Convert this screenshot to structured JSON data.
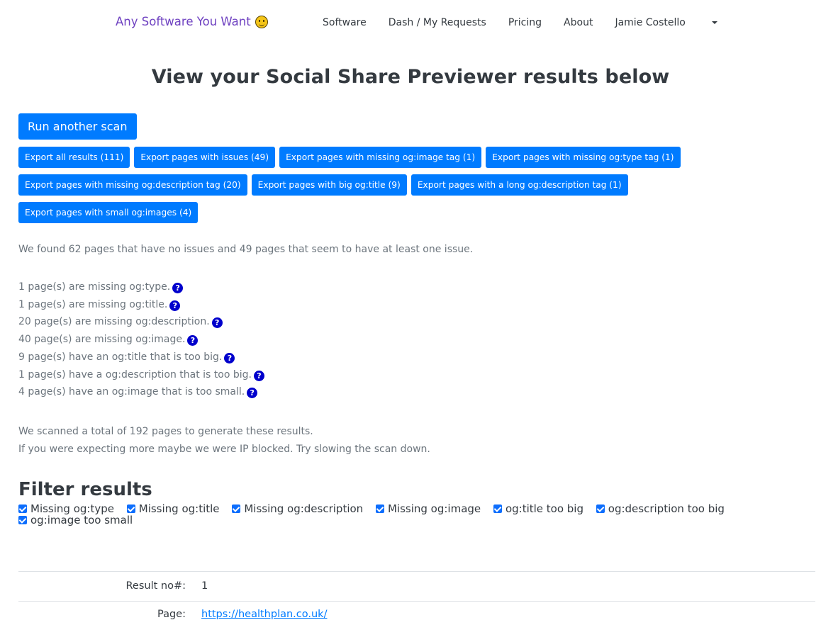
{
  "nav": {
    "brand": "Any Software You Want",
    "links": [
      "Software",
      "Dash / My Requests",
      "Pricing",
      "About",
      "Jamie Costello"
    ]
  },
  "page_title": "View your Social Share Previewer results below",
  "run_scan_label": "Run another scan",
  "export_buttons": [
    "Export all results (111)",
    "Export pages with issues (49)",
    "Export pages with missing og:image tag (1)",
    "Export pages with missing og:type tag (1)",
    "Export pages with missing og:description tag (20)",
    "Export pages with big og:title (9)",
    "Export pages with a long og:description tag (1)",
    "Export pages with small og:images (4)"
  ],
  "summary": "We found 62 pages that have no issues and 49 pages that seem to have at least one issue.",
  "issues": [
    "1 page(s) are missing og:type.",
    "1 page(s) are missing og:title.",
    "20 page(s) are missing og:description.",
    "40 page(s) are missing og:image.",
    "9 page(s) have an og:title that is too big.",
    "1 page(s) have a og:description that is too big.",
    "4 page(s) have an og:image that is too small."
  ],
  "help_icon_glyph": "?",
  "scan_note_1": "We scanned a total of 192 pages to generate these results.",
  "scan_note_2": "If you were expecting more maybe we were IP blocked. Try slowing the scan down.",
  "filter_title": "Filter results",
  "filters": [
    "Missing og:type",
    "Missing og:title",
    "Missing og:description",
    "Missing og:image",
    "og:title too big",
    "og:description too big",
    "og:image too small"
  ],
  "result": {
    "number_label": "Result no#:",
    "number_value": "1",
    "page_label": "Page:",
    "page_value": "https://healthplan.co.uk/"
  },
  "colors": {
    "primary": "#007bff",
    "brand": "#6f42c1",
    "help_icon": "#0000cc"
  }
}
